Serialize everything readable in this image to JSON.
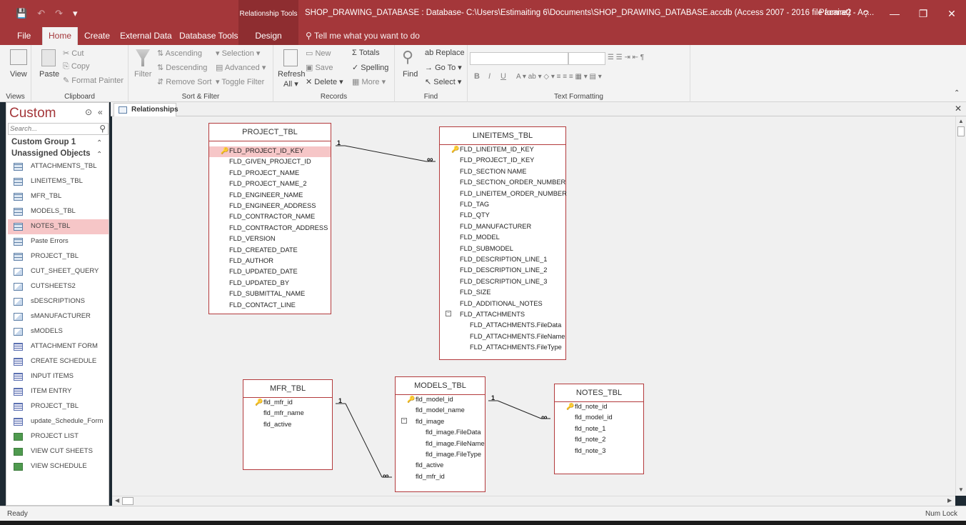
{
  "titlebar": {
    "qat": [
      "💾",
      "↶",
      "↷",
      "▾"
    ],
    "tools_tag": "Relationship Tools",
    "title": "SHOP_DRAWING_DATABASE : Database- C:\\Users\\Estimaiting 6\\Documents\\SHOP_DRAWING_DATABASE.accdb (Access 2007 - 2016 file format)  -  Ac...",
    "user": "Pacaire2",
    "help": "?",
    "min": "—",
    "restore": "❐",
    "close": "✕"
  },
  "tabs": [
    {
      "label": "File"
    },
    {
      "label": "Home"
    },
    {
      "label": "Create"
    },
    {
      "label": "External Data"
    },
    {
      "label": "Database Tools"
    },
    {
      "label": "Design"
    }
  ],
  "tell_me": "Tell me what you want to do",
  "ribbon": {
    "views": {
      "view": "View",
      "label": "Views"
    },
    "clipboard": {
      "paste": "Paste",
      "cut": "Cut",
      "copy": "Copy",
      "format_painter": "Format Painter",
      "label": "Clipboard"
    },
    "sort_filter": {
      "filter": "Filter",
      "ascending": "Ascending",
      "descending": "Descending",
      "remove_sort": "Remove Sort",
      "selection": "Selection",
      "advanced": "Advanced",
      "toggle_filter": "Toggle Filter",
      "label": "Sort & Filter"
    },
    "records": {
      "refresh": "Refresh",
      "all": "All",
      "new": "New",
      "save": "Save",
      "delete": "Delete",
      "totals": "Totals",
      "spelling": "Spelling",
      "more": "More",
      "label": "Records"
    },
    "find": {
      "find": "Find",
      "replace": "Replace",
      "goto": "Go To",
      "select": "Select",
      "label": "Find"
    },
    "text_formatting": {
      "bold": "B",
      "italic": "I",
      "underline": "U",
      "label": "Text Formatting"
    }
  },
  "nav": {
    "title": "Custom",
    "search_placeholder": "Search...",
    "group1": "Custom Group 1",
    "group2": "Unassigned Objects",
    "items": [
      {
        "label": "ATTACHMENTS_TBL",
        "type": "table"
      },
      {
        "label": "LINEITEMS_TBL",
        "type": "table"
      },
      {
        "label": "MFR_TBL",
        "type": "table"
      },
      {
        "label": "MODELS_TBL",
        "type": "table"
      },
      {
        "label": "NOTES_TBL",
        "type": "table"
      },
      {
        "label": "Paste Errors",
        "type": "table"
      },
      {
        "label": "PROJECT_TBL",
        "type": "table"
      },
      {
        "label": "CUT_SHEET_QUERY",
        "type": "query"
      },
      {
        "label": "CUTSHEETS2",
        "type": "query"
      },
      {
        "label": "sDESCRIPTIONS",
        "type": "query"
      },
      {
        "label": "sMANUFACTURER",
        "type": "query"
      },
      {
        "label": "sMODELS",
        "type": "query"
      },
      {
        "label": "ATTACHMENT FORM",
        "type": "form"
      },
      {
        "label": "CREATE SCHEDULE",
        "type": "form"
      },
      {
        "label": "INPUT ITEMS",
        "type": "form"
      },
      {
        "label": "ITEM ENTRY",
        "type": "form"
      },
      {
        "label": "PROJECT_TBL",
        "type": "form"
      },
      {
        "label": "update_Schedule_Form",
        "type": "form"
      },
      {
        "label": "PROJECT LIST",
        "type": "report"
      },
      {
        "label": "VIEW CUT SHEETS",
        "type": "report"
      },
      {
        "label": "VIEW SCHEDULE",
        "type": "report"
      }
    ]
  },
  "doc_tab": "Relationships",
  "tables": [
    {
      "name": "PROJECT_TBL",
      "fields": [
        {
          "name": "FLD_PROJECT_ID_KEY",
          "key": true
        },
        {
          "name": "FLD_GIVEN_PROJECT_ID"
        },
        {
          "name": "FLD_PROJECT_NAME"
        },
        {
          "name": "FLD_PROJECT_NAME_2"
        },
        {
          "name": "FLD_ENGINEER_NAME"
        },
        {
          "name": "FLD_ENGINEER_ADDRESS"
        },
        {
          "name": "FLD_CONTRACTOR_NAME"
        },
        {
          "name": "FLD_CONTRACTOR_ADDRESS"
        },
        {
          "name": "FLD_VERSION"
        },
        {
          "name": "FLD_CREATED_DATE"
        },
        {
          "name": "FLD_AUTHOR"
        },
        {
          "name": "FLD_UPDATED_DATE"
        },
        {
          "name": "FLD_UPDATED_BY"
        },
        {
          "name": "FLD_SUBMITTAL_NAME"
        },
        {
          "name": "FLD_CONTACT_LINE"
        }
      ]
    },
    {
      "name": "LINEITEMS_TBL",
      "fields": [
        {
          "name": "FLD_LINEITEM_ID_KEY",
          "key": true
        },
        {
          "name": "FLD_PROJECT_ID_KEY"
        },
        {
          "name": "FLD_SECTION NAME"
        },
        {
          "name": "FLD_SECTION_ORDER_NUMBER"
        },
        {
          "name": "FLD_LINEITEM_ORDER_NUMBER"
        },
        {
          "name": "FLD_TAG"
        },
        {
          "name": "FLD_QTY"
        },
        {
          "name": "FLD_MANUFACTURER"
        },
        {
          "name": "FLD_MODEL"
        },
        {
          "name": "FLD_SUBMODEL"
        },
        {
          "name": "FLD_DESCRIPTION_LINE_1"
        },
        {
          "name": "FLD_DESCRIPTION_LINE_2"
        },
        {
          "name": "FLD_DESCRIPTION_LINE_3"
        },
        {
          "name": "FLD_SIZE"
        },
        {
          "name": "FLD_ADDITIONAL_NOTES"
        },
        {
          "name": "FLD_ATTACHMENTS",
          "expandable": true
        },
        {
          "name": "FLD_ATTACHMENTS.FileData",
          "sub": true
        },
        {
          "name": "FLD_ATTACHMENTS.FileName",
          "sub": true
        },
        {
          "name": "FLD_ATTACHMENTS.FileType",
          "sub": true
        }
      ]
    },
    {
      "name": "MFR_TBL",
      "fields": [
        {
          "name": "fld_mfr_id",
          "key": true
        },
        {
          "name": "fld_mfr_name"
        },
        {
          "name": "fld_active"
        }
      ]
    },
    {
      "name": "MODELS_TBL",
      "fields": [
        {
          "name": "fld_model_id",
          "key": true
        },
        {
          "name": "fld_model_name"
        },
        {
          "name": "fld_image",
          "expandable": true
        },
        {
          "name": "fld_image.FileData",
          "sub": true
        },
        {
          "name": "fld_image.FileName",
          "sub": true
        },
        {
          "name": "fld_image.FileType",
          "sub": true
        },
        {
          "name": "fld_active"
        },
        {
          "name": "fld_mfr_id"
        }
      ]
    },
    {
      "name": "NOTES_TBL",
      "fields": [
        {
          "name": "fld_note_id",
          "key": true
        },
        {
          "name": "fld_model_id"
        },
        {
          "name": "fld_note_1"
        },
        {
          "name": "fld_note_2"
        },
        {
          "name": "fld_note_3"
        }
      ]
    }
  ],
  "relationships": {
    "one": "1",
    "many": "∞"
  },
  "status": {
    "left": "Ready",
    "right": "Num Lock"
  }
}
